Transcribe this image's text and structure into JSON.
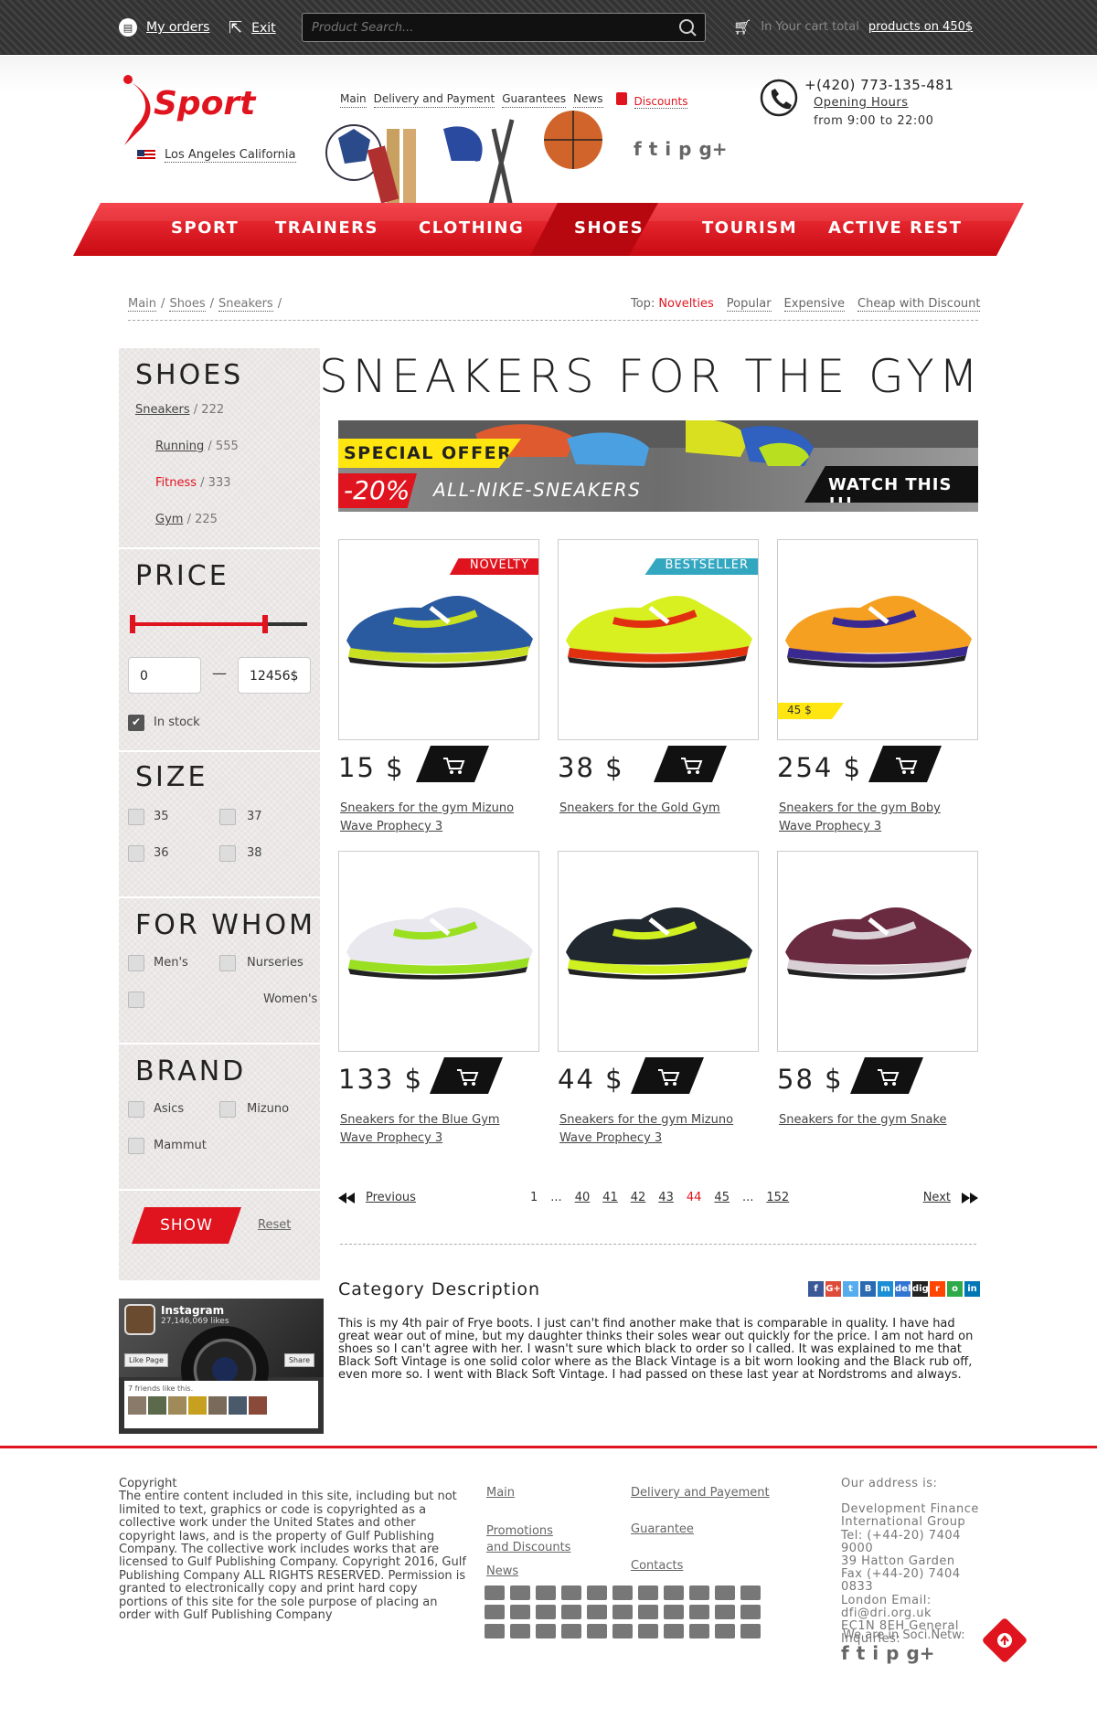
{
  "topbar": {
    "my_orders": "My orders",
    "exit": "Exit",
    "search_placeholder": "Product Search...",
    "cart_prefix": "In Your cart total",
    "cart_link": "products on 450$"
  },
  "header": {
    "logo_text": "Sport",
    "location": "Los Angeles California",
    "nav": [
      "Main",
      "Delivery and Payment",
      "Guarantees",
      "News"
    ],
    "discounts": "Discounts",
    "phone": "+(420) 773-135-481",
    "opening_hours_label": "Opening Hours",
    "hours": "from 9:00 to 22:00",
    "social": [
      "f",
      "t",
      "i",
      "p",
      "g+"
    ]
  },
  "main_nav": {
    "items": [
      "SPORT",
      "TRAINERS",
      "CLOTHING",
      "SHOES",
      "TOURISM",
      "ACTIVE REST"
    ],
    "active": "SHOES"
  },
  "breadcrumbs": [
    "Main",
    "Shoes",
    "Sneakers"
  ],
  "top_filter": {
    "label": "Top:",
    "items": [
      "Novelties",
      "Popular",
      "Expensive",
      "Cheap with Discount"
    ],
    "active": "Novelties"
  },
  "sidebar": {
    "shoes": {
      "title": "SHOES",
      "items": [
        {
          "label": "Sneakers",
          "count": "/ 222"
        },
        {
          "label": "Running",
          "count": "/ 555"
        },
        {
          "label": "Fitness",
          "count": "/ 333"
        },
        {
          "label": "Gym",
          "count": "/ 225"
        }
      ]
    },
    "price": {
      "title": "PRICE",
      "min": "0",
      "max": "12456$",
      "dash": "—",
      "in_stock": "In stock",
      "in_stock_checked": true
    },
    "size": {
      "title": "SIZE",
      "options": [
        "35",
        "37",
        "36",
        "38"
      ]
    },
    "for_whom": {
      "title": "FOR WHOM",
      "options": [
        "Men's",
        "Nurseries",
        "Women's"
      ]
    },
    "brand": {
      "title": "BRAND",
      "options": [
        "Asics",
        "Mizuno",
        "Mammut"
      ]
    },
    "show_button": "SHOW",
    "reset": "Reset"
  },
  "instagram": {
    "name": "Instagram",
    "likes": "27,146,069 likes",
    "like_page": "Like Page",
    "share": "Share",
    "friends": "7 friends like this."
  },
  "content": {
    "title": "SNEAKERS FOR THE GYM",
    "banner": {
      "special": "SPECIAL OFFER",
      "discount": "-20%",
      "text": "ALL-NIKE-SNEAKERS",
      "cta": "WATCH THIS !!!"
    },
    "products": [
      {
        "price": "15 $",
        "name": "Sneakers for the gym Mizuno Wave Prophecy 3",
        "tag": "NOVELTY",
        "tag_color": "#e0141e",
        "shoe_color": "#2a5aa0",
        "accent": "#c8e020"
      },
      {
        "price": "38 $",
        "name": "Sneakers for the Gold Gym",
        "tag": "BESTSELLER",
        "tag_color": "#34a7c0",
        "shoe_color": "#d8f020",
        "accent": "#e03010"
      },
      {
        "price": "254 $",
        "name": "Sneakers for the gym Boby Wave Prophecy 3",
        "old_price": "45 $",
        "shoe_color": "#f5a020",
        "accent": "#3a2a90"
      },
      {
        "price": "133 $",
        "name": "Sneakers for the Blue Gym Wave Prophecy 3",
        "shoe_color": "#e8e8ee",
        "accent": "#9ae020"
      },
      {
        "price": "44 $",
        "name": "Sneakers for the gym Mizuno Wave Prophecy 3",
        "shoe_color": "#222830",
        "accent": "#d0f020"
      },
      {
        "price": "58 $",
        "name": "Sneakers for the gym Snake",
        "shoe_color": "#6a2a40",
        "accent": "#d8d0d4"
      }
    ],
    "pager": {
      "previous": "Previous",
      "next": "Next",
      "pages": [
        "1",
        "...",
        "40",
        "41",
        "42",
        "43",
        "44",
        "45",
        "...",
        "152"
      ],
      "current": "44"
    },
    "category_title": "Category Description",
    "category_text": "This is my 4th pair of Frye boots. I just can't find another make that is comparable in quality. I have had great wear out of mine, but my daughter thinks their soles wear out quickly for the price. I am not hard on shoes so I can't agree with her. I wasn't sure which black to order so I called. It was explained to me that Black Soft Vintage is one solid color where as the Black Vintage is a bit worn looking and the Black rub off, even more so. I went with Black Soft Vintage. I had passed on these last year at Nordstroms and always.",
    "share_icons": [
      "f",
      "G+",
      "t",
      "B",
      "m",
      "del",
      "digg",
      "r",
      "o",
      "in"
    ]
  },
  "footer": {
    "copyright": "Copyright\nThe entire content included in this site, including but not limited to text, graphics or code is copyrighted as a collective work under the United States and other copyright laws, and is the property of Gulf Publishing Company. The collective work includes works that are licensed to Gulf Publishing Company. Copyright 2016, Gulf Publishing Company ALL RIGHTS RESERVED. Permission is granted to electronically copy and print hard copy portions of this site for the sole purpose of placing an order with Gulf Publishing Company",
    "links_col1": [
      "Main",
      "Promotions and Discounts",
      "News"
    ],
    "links_col2": [
      "Delivery and Payement",
      "Guarantee",
      "Contacts"
    ],
    "address_title": "Our address is:",
    "address": "Development Finance International Group\nTel: (+44-20) 7404 9000\n39 Hatton Garden\nFax (+44-20) 7404 0833\nLondon Email: dfi@dri.org.uk\nEC1N 8EH General Inquiries:",
    "social_label": "We are in Soci.Netw:"
  },
  "colors": {
    "brand_red": "#e0141e",
    "accent_blue": "#34a7c0",
    "highlight_yellow": "#ffe610"
  }
}
